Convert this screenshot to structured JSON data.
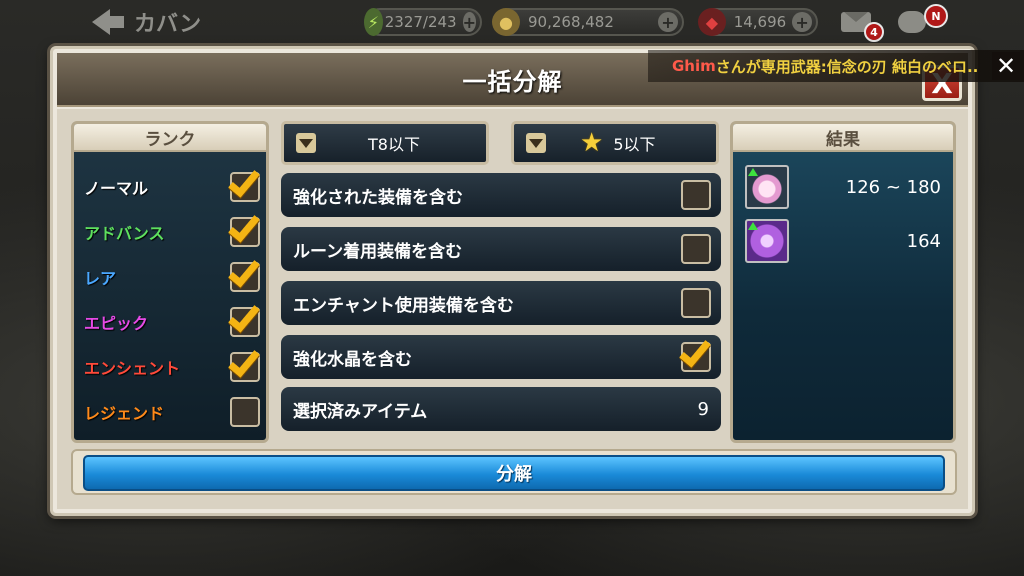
{
  "topbar": {
    "back_label": "カバン",
    "stamina": "2327/243",
    "gold": "90,268,482",
    "gems": "14,696",
    "mail_badge": "4",
    "chat_badge": "N",
    "plus": "+"
  },
  "banner": {
    "name": "Ghim",
    "text": "さんが専用武器:信念の刃 純白のベロ..",
    "close": "✕"
  },
  "modal": {
    "title": "一括分解",
    "close": "X"
  },
  "rank": {
    "header": "ランク",
    "items": [
      {
        "label": "ノーマル",
        "color": "#ffffff",
        "checked": true
      },
      {
        "label": "アドバンス",
        "color": "#5ee05e",
        "checked": true
      },
      {
        "label": "レア",
        "color": "#4aa8ff",
        "checked": true
      },
      {
        "label": "エピック",
        "color": "#e64ae6",
        "checked": true
      },
      {
        "label": "エンシェント",
        "color": "#ff4a3a",
        "checked": true
      },
      {
        "label": "レジェンド",
        "color": "#ff8a1a",
        "checked": false
      }
    ]
  },
  "filters": {
    "tier": "T8以下",
    "stars": "5以下"
  },
  "options": [
    {
      "label": "強化された装備を含む",
      "checked": false
    },
    {
      "label": "ルーン着用装備を含む",
      "checked": false
    },
    {
      "label": "エンチャント使用装備を含む",
      "checked": false
    },
    {
      "label": "強化水晶を含む",
      "checked": true
    }
  ],
  "selected": {
    "label": "選択済みアイテム",
    "count": "9"
  },
  "result": {
    "header": "結果",
    "items": [
      {
        "icon": "pink-crystal-icon",
        "value": "126 ~ 180"
      },
      {
        "icon": "purple-crystal-icon",
        "value": "164"
      }
    ]
  },
  "action": {
    "disassemble": "分解"
  }
}
